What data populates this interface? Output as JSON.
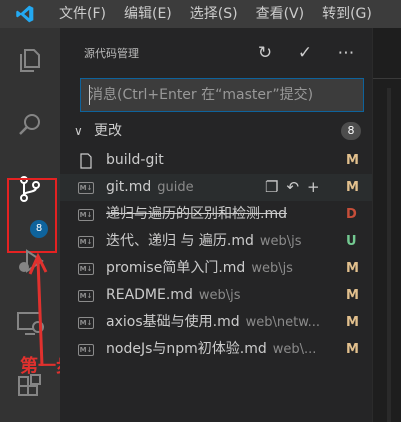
{
  "menubar": {
    "items": [
      "文件(F)",
      "编辑(E)",
      "选择(S)",
      "查看(V)",
      "转到(G)"
    ]
  },
  "activity_bar": {
    "scm_badge": "8"
  },
  "annotation": {
    "text": "第一步"
  },
  "scm": {
    "title": "源代码管理",
    "message_placeholder": "消息(Ctrl+Enter 在“master”提交)",
    "changes_label": "更改",
    "changes_count": "8",
    "files": [
      {
        "name": "build-git",
        "path": "",
        "status": "M",
        "icon": "file-icon",
        "deleted": false
      },
      {
        "name": "git.md",
        "path": "guide",
        "status": "M",
        "icon": "markdown-icon",
        "deleted": false
      },
      {
        "name": "递归与遍历的区别和检测.md",
        "path": "",
        "status": "D",
        "icon": "markdown-icon",
        "deleted": true
      },
      {
        "name": "迭代、递归 与 遍历.md",
        "path": "web\\js",
        "status": "U",
        "icon": "markdown-icon",
        "deleted": false
      },
      {
        "name": "promise简单入门.md",
        "path": "web\\js",
        "status": "M",
        "icon": "markdown-icon",
        "deleted": false
      },
      {
        "name": "README.md",
        "path": "web\\js",
        "status": "M",
        "icon": "markdown-icon",
        "deleted": false
      },
      {
        "name": "axios基础与使用.md",
        "path": "web\\netw...",
        "status": "M",
        "icon": "markdown-icon",
        "deleted": false
      },
      {
        "name": "nodeJs与npm初体验.md",
        "path": "web\\...",
        "status": "M",
        "icon": "markdown-icon",
        "deleted": false
      }
    ]
  },
  "colors": {
    "modified": "#e2c08d",
    "deleted": "#c74e39",
    "untracked": "#73c991",
    "accent": "#0e639c",
    "annotation": "#e0312e"
  }
}
